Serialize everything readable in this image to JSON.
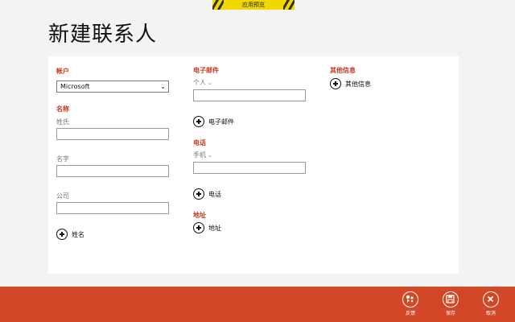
{
  "preview_banner": {
    "label": "应用预览"
  },
  "page": {
    "title": "新建联系人"
  },
  "account": {
    "section_label": "帐户",
    "selected": "Microsoft"
  },
  "name": {
    "section_label": "名称",
    "last_name_label": "姓氏",
    "last_name_value": "",
    "first_name_label": "名字",
    "first_name_value": "",
    "company_label": "公司",
    "company_value": "",
    "add_label": "姓名"
  },
  "email": {
    "section_label": "电子邮件",
    "type_label": "个人",
    "value": "",
    "add_label": "电子邮件"
  },
  "phone": {
    "section_label": "电话",
    "type_label": "手机",
    "value": "",
    "add_label": "电话"
  },
  "address": {
    "section_label": "地址",
    "add_label": "地址"
  },
  "other_info": {
    "section_label": "其他信息",
    "add_label": "其他信息"
  },
  "appbar": {
    "background": "#d24726",
    "feedback_label": "反馈",
    "save_label": "保存",
    "cancel_label": "取消",
    "feedback_icon": "feedback-icon",
    "save_icon": "save-icon",
    "cancel_icon": "close-icon"
  }
}
